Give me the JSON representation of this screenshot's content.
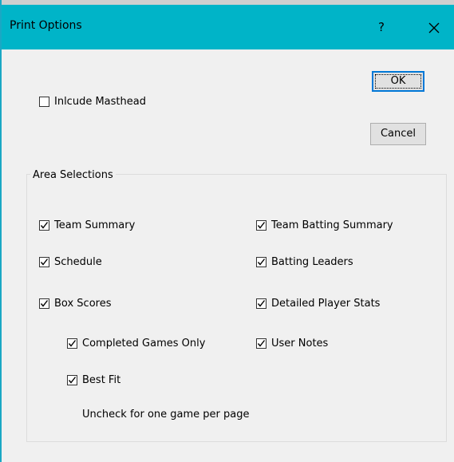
{
  "window": {
    "title": "Print Options",
    "help_label": "?",
    "close_label": "×"
  },
  "buttons": {
    "ok": "OK",
    "cancel": "Cancel"
  },
  "options": {
    "masthead": {
      "label": "Inlcude Masthead",
      "checked": false
    }
  },
  "area_selections": {
    "title": "Area Selections",
    "left": [
      {
        "label": "Team Summary",
        "checked": true
      },
      {
        "label": "Schedule",
        "checked": true
      },
      {
        "label": "Box Scores",
        "checked": true
      },
      {
        "label": "Completed Games Only",
        "checked": true
      },
      {
        "label": "Best Fit",
        "checked": true
      }
    ],
    "right": [
      {
        "label": "Team Batting Summary",
        "checked": true
      },
      {
        "label": "Batting Leaders",
        "checked": true
      },
      {
        "label": "Detailed Player Stats",
        "checked": true
      },
      {
        "label": "User Notes",
        "checked": true
      }
    ],
    "hint": "Uncheck for one game per page"
  },
  "colors": {
    "title_bar": "#00b4c8",
    "window_bg": "#f0f0f0",
    "focus_border": "#0078d7"
  }
}
